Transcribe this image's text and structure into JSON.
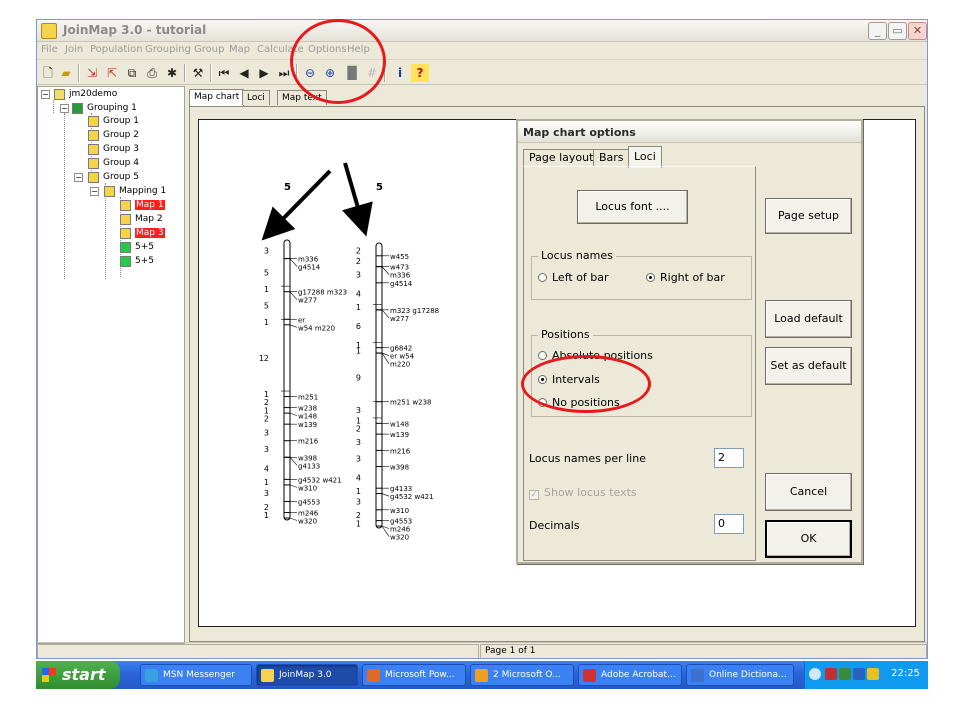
{
  "app": {
    "title": "JoinMap 3.0  - tutorial",
    "menus": [
      "File",
      "Join",
      "Population",
      "Grouping",
      "Group",
      "Map",
      "Calculate",
      "Options",
      "Help"
    ]
  },
  "toolbar": {
    "icons": [
      "new-file-icon",
      "open-folder-icon",
      "import-icon",
      "export-icon",
      "copy-icon",
      "print-icon",
      "tool-icon",
      "hammer-icon",
      "first-icon",
      "previous-icon",
      "next-icon",
      "last-icon",
      "zoom-out-icon",
      "zoom-in-icon",
      "fill-bar-icon",
      "grid-icon",
      "info-icon",
      "help-icon"
    ]
  },
  "tree": {
    "items": [
      {
        "label": "jm20demo",
        "icon": "project-icon",
        "color": "#f0e060",
        "highlight": false
      },
      {
        "label": "Grouping 1",
        "icon": "grouping-icon",
        "color": "#2a9a3a",
        "highlight": false
      },
      {
        "label": "Group 1",
        "icon": "group-icon",
        "color": "#f5d34b",
        "highlight": false
      },
      {
        "label": "Group 2",
        "icon": "group-icon",
        "color": "#f5d34b",
        "highlight": false
      },
      {
        "label": "Group 3",
        "icon": "group-icon",
        "color": "#f5d34b",
        "highlight": false
      },
      {
        "label": "Group 4",
        "icon": "group-icon",
        "color": "#f5d34b",
        "highlight": false
      },
      {
        "label": "Group 5",
        "icon": "group-icon",
        "color": "#f5d34b",
        "highlight": false
      },
      {
        "label": "Mapping 1",
        "icon": "mapping-icon",
        "color": "#f5d34b",
        "highlight": false
      },
      {
        "label": "Map 1",
        "icon": "map-icon",
        "color": "#f5d34b",
        "highlight": true
      },
      {
        "label": "Map 2",
        "icon": "map-icon",
        "color": "#f5d34b",
        "highlight": false
      },
      {
        "label": "Map 3",
        "icon": "map-icon",
        "color": "#f5d34b",
        "highlight": true
      },
      {
        "label": "5+5",
        "icon": "comparison-icon",
        "color": "#2ac84a",
        "highlight": false
      },
      {
        "label": "5+5",
        "icon": "comparison-icon",
        "color": "#2ac84a",
        "highlight": false
      }
    ]
  },
  "doc_tabs": [
    "Map chart",
    "Loci",
    "Map text"
  ],
  "map_chart": {
    "maps": [
      {
        "title": "5",
        "loci": [
          {
            "interval": "3",
            "names": [
              "m336"
            ]
          },
          {
            "interval": "",
            "names": [
              "g4514"
            ]
          },
          {
            "interval": "5",
            "names": []
          },
          {
            "interval": "1",
            "names": [
              "g17288 m323",
              "w277"
            ]
          },
          {
            "interval": "5",
            "names": []
          },
          {
            "interval": "",
            "names": [
              "er"
            ]
          },
          {
            "interval": "1",
            "names": [
              "w54 m220"
            ]
          },
          {
            "interval": "12",
            "names": []
          },
          {
            "interval": "1",
            "names": [
              "m251"
            ]
          },
          {
            "interval": "2",
            "names": [
              "w238"
            ]
          },
          {
            "interval": "1",
            "names": [
              "w148"
            ]
          },
          {
            "interval": "2",
            "names": [
              "w139"
            ]
          },
          {
            "interval": "3",
            "names": [
              "m216"
            ]
          },
          {
            "interval": "3",
            "names": [
              "w398"
            ]
          },
          {
            "interval": "",
            "names": [
              "g4133"
            ]
          },
          {
            "interval": "4",
            "names": [
              "g4532 w421"
            ]
          },
          {
            "interval": "1",
            "names": [
              "w310"
            ]
          },
          {
            "interval": "3",
            "names": [
              "g4553"
            ]
          },
          {
            "interval": "2",
            "names": [
              "m246"
            ]
          },
          {
            "interval": "1",
            "names": [
              "w320"
            ]
          }
        ]
      },
      {
        "title": "5",
        "loci": [
          {
            "interval": "2",
            "names": [
              "w455"
            ]
          },
          {
            "interval": "2",
            "names": [
              "w473"
            ]
          },
          {
            "interval": "",
            "names": [
              "m336"
            ]
          },
          {
            "interval": "3",
            "names": [
              "g4514"
            ]
          },
          {
            "interval": "4",
            "names": []
          },
          {
            "interval": "1",
            "names": [
              "m323 g17288"
            ]
          },
          {
            "interval": "",
            "names": [
              "w277"
            ]
          },
          {
            "interval": "6",
            "names": []
          },
          {
            "interval": "1",
            "names": [
              "g6842"
            ]
          },
          {
            "interval": "1",
            "names": [
              "er w54"
            ]
          },
          {
            "interval": "",
            "names": [
              "m220"
            ]
          },
          {
            "interval": "9",
            "names": []
          },
          {
            "interval": "",
            "names": [
              "m251 w238"
            ]
          },
          {
            "interval": "3",
            "names": []
          },
          {
            "interval": "1",
            "names": [
              "w148"
            ]
          },
          {
            "interval": "2",
            "names": [
              "w139"
            ]
          },
          {
            "interval": "3",
            "names": [
              "m216"
            ]
          },
          {
            "interval": "3",
            "names": [
              "w398"
            ]
          },
          {
            "interval": "4",
            "names": [
              "g4133"
            ]
          },
          {
            "interval": "1",
            "names": [
              "g4532 w421"
            ]
          },
          {
            "interval": "3",
            "names": [
              "w310"
            ]
          },
          {
            "interval": "2",
            "names": [
              "g4553"
            ]
          },
          {
            "interval": "1",
            "names": [
              "m246"
            ]
          },
          {
            "interval": "",
            "names": [
              "w320"
            ]
          }
        ]
      }
    ]
  },
  "dialog": {
    "title": "Map chart options",
    "tabs": [
      "Page layout",
      "Bars",
      "Loci"
    ],
    "selected_tab": "Loci",
    "locus_font_button": "Locus font ....",
    "locus_names_group": "Locus names",
    "locus_names_options": [
      "Left of bar",
      "Right of bar"
    ],
    "locus_names_selected": "Right of bar",
    "positions_group": "Positions",
    "positions_options": [
      "Absolute positions",
      "Intervals",
      "No positions"
    ],
    "positions_selected": "Intervals",
    "locus_names_per_line_label": "Locus names per line",
    "locus_names_per_line_value": "2",
    "show_locus_texts_label": "Show locus texts",
    "decimals_label": "Decimals",
    "decimals_value": "0",
    "buttons": {
      "page_setup": "Page setup",
      "load_default": "Load default",
      "set_as_default": "Set as default",
      "cancel": "Cancel",
      "ok": "OK"
    }
  },
  "status": {
    "page": "Page 1 of 1"
  },
  "taskbar": {
    "start": "start",
    "tasks": [
      {
        "label": "MSN Messenger",
        "color": "#3aa0e0"
      },
      {
        "label": "JoinMap 3.0",
        "color": "#f5d34b",
        "active": true
      },
      {
        "label": "Microsoft Pow...",
        "color": "#e06a2a"
      },
      {
        "label": "2 Microsoft O...",
        "color": "#f0a020"
      },
      {
        "label": "Adobe Acrobat...",
        "color": "#d03030"
      },
      {
        "label": "Online Dictiona...",
        "color": "#3a70d0"
      }
    ],
    "clock": "22:25"
  },
  "colors": {
    "highlight": "#ff1e1e",
    "annotation": "#e8191d"
  }
}
